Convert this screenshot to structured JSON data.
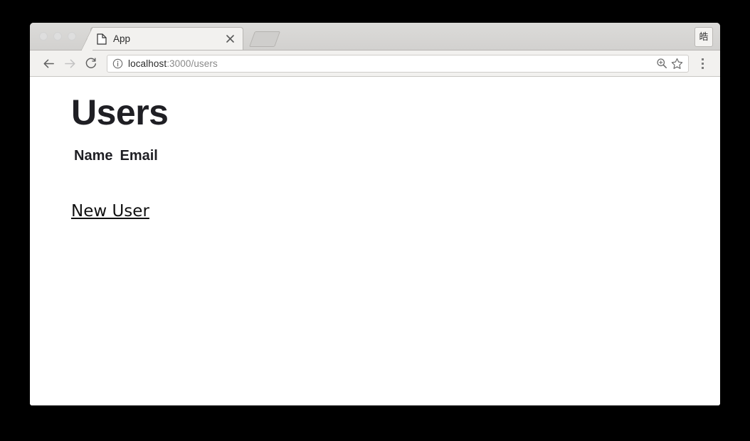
{
  "browser": {
    "tab": {
      "title": "App",
      "favicon_icon": "document-icon",
      "close_icon": "close-icon"
    },
    "new_tab_button_icon": "new-tab-icon",
    "profile_button_label": "皓",
    "toolbar": {
      "back_icon": "arrow-left-icon",
      "forward_icon": "arrow-right-icon",
      "reload_icon": "reload-icon",
      "site_info_icon": "info-circle-icon",
      "url_host": "localhost",
      "url_path": ":3000/users",
      "url_full": "localhost:3000/users",
      "zoom_icon": "zoom-search-icon",
      "bookmark_icon": "star-icon",
      "menu_icon": "three-dot-menu-icon"
    },
    "window_controls": [
      "close",
      "minimize",
      "maximize"
    ]
  },
  "page": {
    "title": "Users",
    "table": {
      "headers": [
        "Name",
        "Email"
      ],
      "rows": []
    },
    "new_user_link": "New User"
  }
}
